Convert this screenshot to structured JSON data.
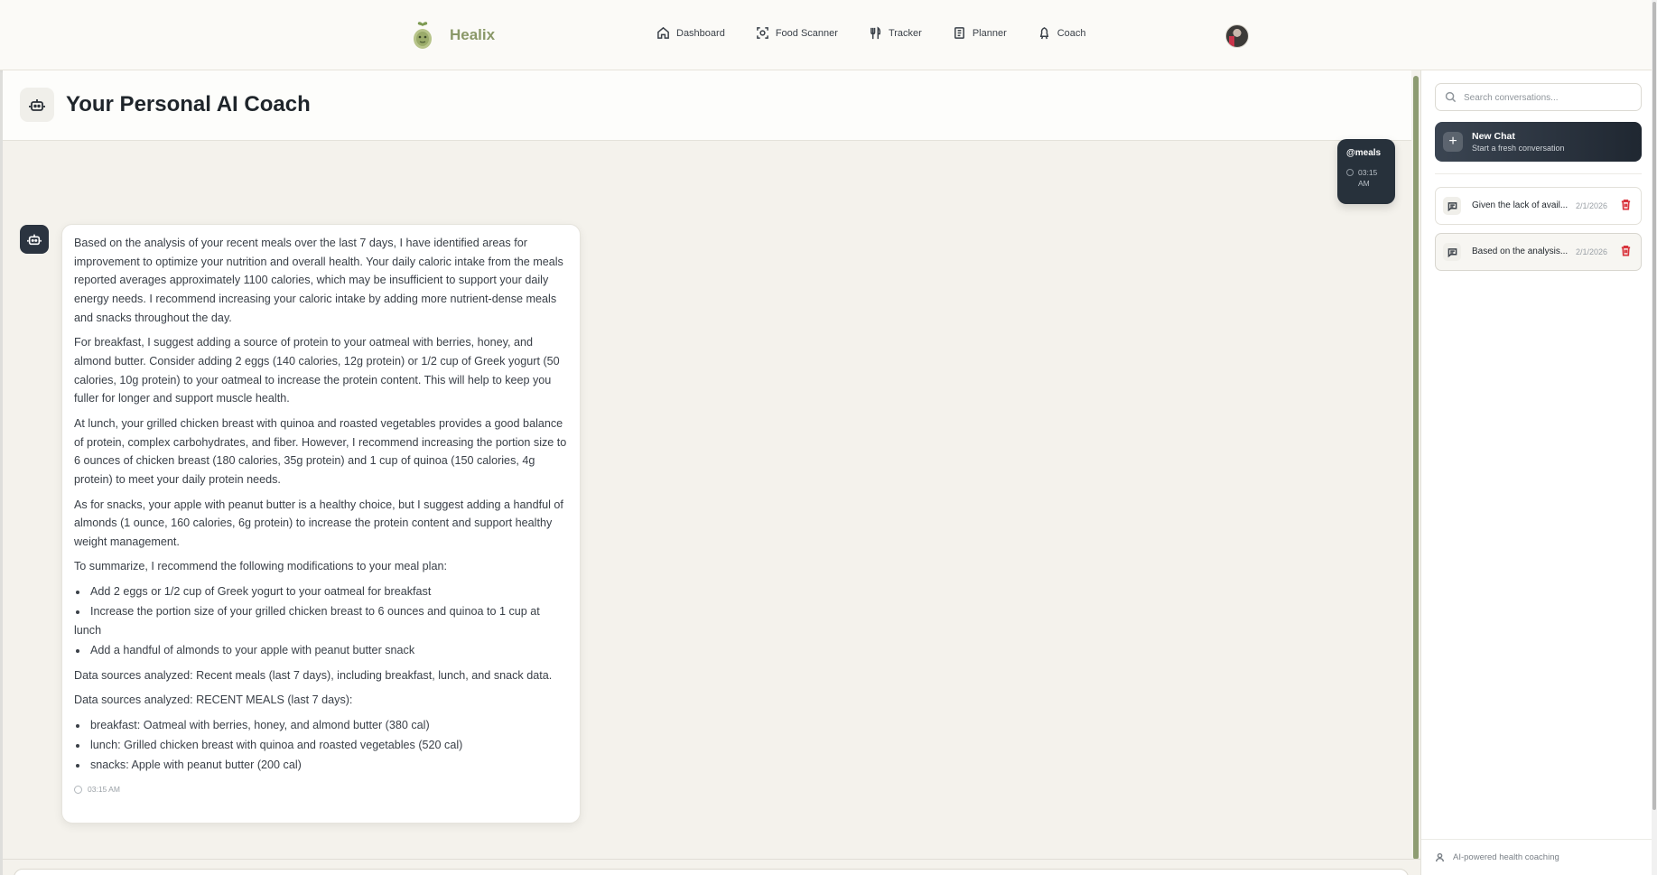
{
  "brand": {
    "name": "Healix"
  },
  "nav": [
    {
      "label": "Dashboard",
      "icon": "home-icon"
    },
    {
      "label": "Food Scanner",
      "icon": "scan-icon"
    },
    {
      "label": "Tracker",
      "icon": "utensils-icon"
    },
    {
      "label": "Planner",
      "icon": "notebook-icon"
    },
    {
      "label": "Coach",
      "icon": "coach-icon"
    }
  ],
  "header": {
    "title": "Your Personal AI Coach",
    "icon": "bot-icon"
  },
  "user_message": {
    "text": "@meals",
    "time": "03:15 AM"
  },
  "bot_message": {
    "paragraphs": [
      "Based on the analysis of your recent meals over the last 7 days, I have identified areas for improvement to optimize your nutrition and overall health. Your daily caloric intake from the meals reported averages approximately 1100 calories, which may be insufficient to support your daily energy needs. I recommend increasing your caloric intake by adding more nutrient-dense meals and snacks throughout the day.",
      "For breakfast, I suggest adding a source of protein to your oatmeal with berries, honey, and almond butter. Consider adding 2 eggs (140 calories, 12g protein) or 1/2 cup of Greek yogurt (50 calories, 10g protein) to your oatmeal to increase the protein content. This will help to keep you fuller for longer and support muscle health.",
      "At lunch, your grilled chicken breast with quinoa and roasted vegetables provides a good balance of protein, complex carbohydrates, and fiber. However, I recommend increasing the portion size to 6 ounces of chicken breast (180 calories, 35g protein) and 1 cup of quinoa (150 calories, 4g protein) to meet your daily protein needs.",
      "As for snacks, your apple with peanut butter is a healthy choice, but I suggest adding a handful of almonds (1 ounce, 160 calories, 6g protein) to increase the protein content and support healthy weight management.",
      "To summarize, I recommend the following modifications to your meal plan:"
    ],
    "recommendations": [
      "Add 2 eggs or 1/2 cup of Greek yogurt to your oatmeal for breakfast",
      "Increase the portion size of your grilled chicken breast to 6 ounces and quinoa to 1 cup at lunch",
      "Add a handful of almonds to your apple with peanut butter snack"
    ],
    "sources_summary": "Data sources analyzed: Recent meals (last 7 days), including breakfast, lunch, and snack data.",
    "sources_header": "Data sources analyzed: RECENT MEALS (last 7 days):",
    "meals": [
      "breakfast: Oatmeal with berries, honey, and almond butter (380 cal)",
      "lunch: Grilled chicken breast with quinoa and roasted vegetables (520 cal)",
      "snacks: Apple with peanut butter (200 cal)"
    ],
    "time": "03:15 AM"
  },
  "sidebar": {
    "search_placeholder": "Search conversations...",
    "new_chat": {
      "title": "New Chat",
      "subtitle": "Start a fresh conversation"
    },
    "conversations": [
      {
        "title": "Given the lack of avail...",
        "date": "2/1/2026"
      },
      {
        "title": "Based on the analysis...",
        "date": "2/1/2026"
      }
    ],
    "footer": "AI-powered health coaching"
  },
  "colors": {
    "accent": "#8a9868",
    "dark": "#27313b",
    "danger": "#d8333c",
    "background": "#f4f2ec"
  }
}
